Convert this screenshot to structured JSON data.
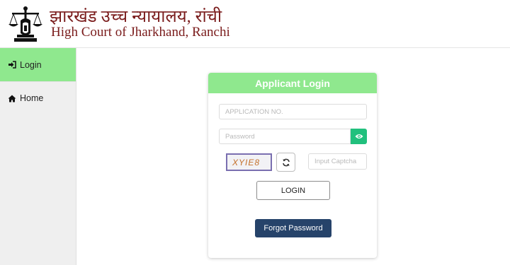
{
  "header": {
    "title_hindi": "झारखंड उच्च न्यायालय, रांची",
    "title_english": "High Court of Jharkhand, Ranchi",
    "logo_icon": "scales-of-justice-emblem-icon"
  },
  "sidebar": {
    "items": [
      {
        "label": "Login",
        "icon": "sign-in-icon",
        "active": true
      },
      {
        "label": "Home",
        "icon": "home-icon",
        "active": false
      }
    ]
  },
  "login_card": {
    "title": "Applicant Login",
    "application_no": {
      "placeholder": "APPLICATION NO.",
      "value": ""
    },
    "password": {
      "placeholder": "Password",
      "value": ""
    },
    "show_password_icon": "eye-icon",
    "captcha_text": "XYIE8",
    "refresh_icon": "refresh-icon",
    "captcha_input": {
      "placeholder": "Input Captcha",
      "value": ""
    },
    "login_label": "LOGIN",
    "forgot_label": "Forgot Password"
  },
  "colors": {
    "accent_green": "#8fe88e",
    "eye_button": "#21c07d",
    "forgot_button": "#26436a",
    "title_maroon": "#7a1c1c"
  }
}
